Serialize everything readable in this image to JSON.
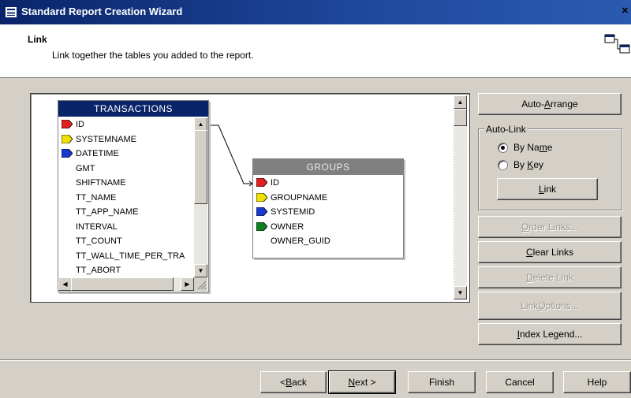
{
  "window": {
    "title": "Standard Report Creation Wizard",
    "close_glyph": "×"
  },
  "header": {
    "title": "Link",
    "description": "Link together the tables you added to the report."
  },
  "tables": {
    "transactions": {
      "name": "TRANSACTIONS",
      "fields": [
        "ID",
        "SYSTEMNAME",
        "DATETIME",
        "GMT",
        "SHIFTNAME",
        "TT_NAME",
        "TT_APP_NAME",
        "INTERVAL",
        "TT_COUNT",
        "TT_WALL_TIME_PER_TRA",
        "TT_ABORT"
      ]
    },
    "groups": {
      "name": "GROUPS",
      "fields": [
        "ID",
        "GROUPNAME",
        "SYSTEMID",
        "OWNER",
        "OWNER_GUID"
      ]
    }
  },
  "buttons": {
    "auto_arrange": {
      "pre": "Auto-",
      "u": "A",
      "post": "rrange"
    },
    "link": {
      "pre": "",
      "u": "L",
      "post": "ink"
    },
    "order_links": {
      "pre": "",
      "u": "O",
      "post": "rder Links..."
    },
    "clear_links": {
      "pre": "",
      "u": "C",
      "post": "lear Links"
    },
    "delete_link": {
      "pre": "",
      "u": "D",
      "post": "elete Link"
    },
    "link_options": {
      "pre": "Link ",
      "u": "O",
      "post": "ptions..."
    },
    "index_legend": {
      "pre": "",
      "u": "I",
      "post": "ndex Legend..."
    },
    "back": {
      "pre": "< ",
      "u": "B",
      "post": "ack"
    },
    "next": {
      "pre": "",
      "u": "N",
      "post": "ext >"
    },
    "finish": "Finish",
    "cancel": "Cancel",
    "help": "Help"
  },
  "autolink": {
    "legend": "Auto-Link",
    "by_name": {
      "pre": "By Na",
      "u": "m",
      "post": "e"
    },
    "by_key": {
      "pre": "By ",
      "u": "K",
      "post": "ey"
    },
    "selected": "by_name"
  },
  "colors": {
    "titlebar": "#0a246a",
    "transactions_header": "#0a246a",
    "groups_header": "#808080",
    "key_red": "#e02020",
    "key_yellow": "#f0e000",
    "key_blue": "#1838d0",
    "key_green": "#108020"
  },
  "icons": [
    "window-icon",
    "close-icon",
    "link-tables-icon",
    "scroll-up-icon",
    "scroll-down-icon",
    "scroll-left-icon",
    "scroll-right-icon",
    "resize-grip-icon"
  ]
}
